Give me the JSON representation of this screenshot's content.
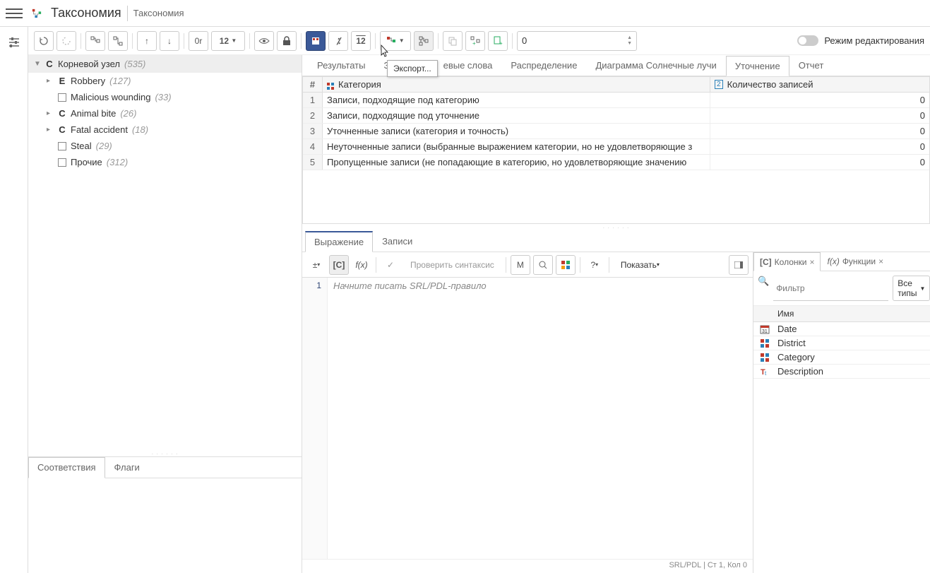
{
  "header": {
    "title": "Таксономия",
    "breadcrumb": "Таксономия"
  },
  "toolbar": {
    "or_label": "0r",
    "dropdown12": "12",
    "calendar12": "12",
    "num_input": "0",
    "edit_mode_label": "Режим редактирования"
  },
  "tooltip": {
    "export_label": "Экспорт..."
  },
  "tree": {
    "root": {
      "type": "C",
      "label": "Корневой узел",
      "count": "(535)"
    },
    "items": [
      {
        "caret": "▸",
        "type": "E",
        "label": "Robbery",
        "count": "(127)"
      },
      {
        "caret": "",
        "type": "icon",
        "label": "Malicious wounding",
        "count": "(33)"
      },
      {
        "caret": "▸",
        "type": "C",
        "label": "Animal bite",
        "count": "(26)"
      },
      {
        "caret": "▸",
        "type": "C",
        "label": "Fatal accident",
        "count": "(18)"
      },
      {
        "caret": "",
        "type": "icon",
        "label": "Steal",
        "count": "(29)"
      },
      {
        "caret": "",
        "type": "icon",
        "label": "Прочие",
        "count": "(312)"
      }
    ]
  },
  "bottom_tabs": {
    "matches": "Соответствия",
    "flags": "Флаги"
  },
  "right_tabs": {
    "results": "Результаты",
    "records_partial": "Зап",
    "keywords_partial": "евые слова",
    "distribution": "Распределение",
    "sunburst": "Диаграмма Солнечные лучи",
    "refinement": "Уточнение",
    "report": "Отчет"
  },
  "category_table": {
    "col_num": "#",
    "col_category": "Категория",
    "col_count": "Количество записей",
    "rows": [
      {
        "n": "1",
        "cat": "Записи, подходящие под категорию",
        "count": "0"
      },
      {
        "n": "2",
        "cat": "Записи, подходящие под уточнение",
        "count": "0"
      },
      {
        "n": "3",
        "cat": "Уточненные записи (категория и точность)",
        "count": "0"
      },
      {
        "n": "4",
        "cat": "Неуточненные записи (выбранные выражением категории, но не удовлетворяющие з",
        "count": "0"
      },
      {
        "n": "5",
        "cat": "Пропущенные записи (не попадающие в категорию, но удовлетворяющие значению",
        "count": "0"
      }
    ]
  },
  "expr_tabs": {
    "expression": "Выражение",
    "records": "Записи"
  },
  "expr_toolbar": {
    "c_bracket": "[C]",
    "fx": "f(x)",
    "check_syntax": "Проверить синтаксис",
    "m_label": "M",
    "show_label": "Показать"
  },
  "editor": {
    "line1": "1",
    "placeholder": "Начните писать SRL/PDL-правило",
    "status": "SRL/PDL | Ст 1, Кол 0"
  },
  "columns_panel": {
    "tab_columns": "Колонки",
    "tab_functions": "Функции",
    "c_prefix": "[C]",
    "fx_prefix": "f(x)",
    "filter_placeholder": "Фильтр",
    "types_label": "Все типы",
    "header_name": "Имя",
    "items": [
      {
        "icon": "date",
        "name": "Date"
      },
      {
        "icon": "grid",
        "name": "District"
      },
      {
        "icon": "grid",
        "name": "Category"
      },
      {
        "icon": "text",
        "name": "Description"
      }
    ]
  }
}
